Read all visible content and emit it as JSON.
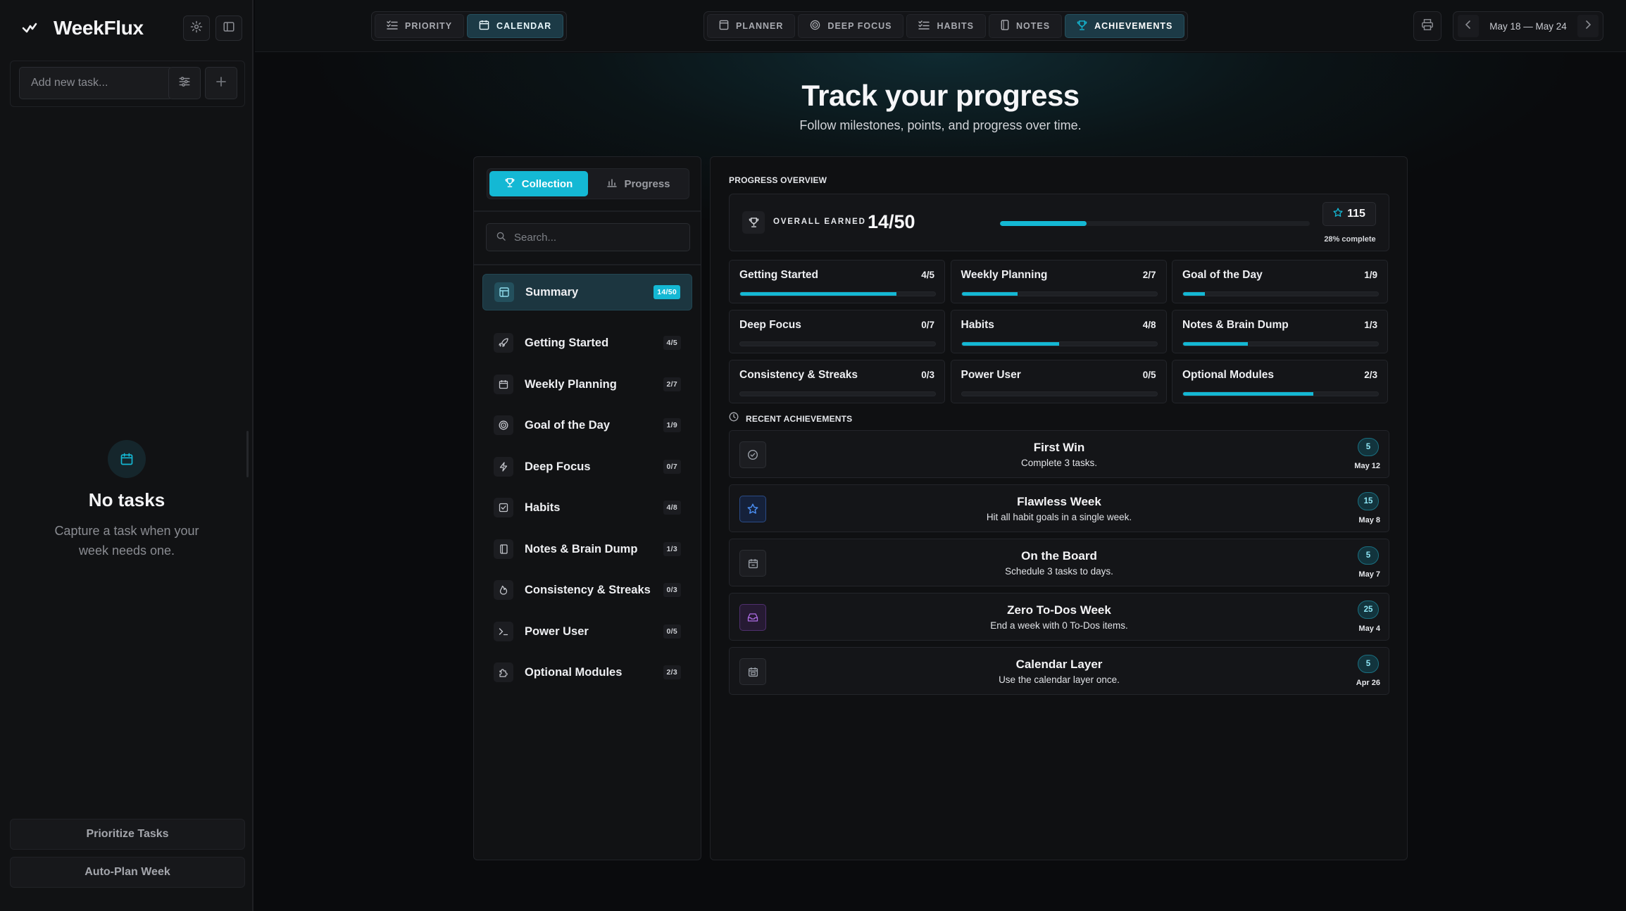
{
  "app": {
    "name": "WeekFlux"
  },
  "sidebar": {
    "add_task_placeholder": "Add new task...",
    "empty_title": "No tasks",
    "empty_subtitle": "Capture a task when your week needs one.",
    "prioritize_label": "Prioritize Tasks",
    "autoplan_label": "Auto-Plan Week"
  },
  "topbar": {
    "left_tabs": [
      {
        "label": "PRIORITY",
        "icon": "list-icon"
      },
      {
        "label": "CALENDAR",
        "icon": "calendar-icon"
      }
    ],
    "main_tabs": [
      {
        "label": "PLANNER",
        "icon": "planner-icon"
      },
      {
        "label": "DEEP FOCUS",
        "icon": "target-icon"
      },
      {
        "label": "HABITS",
        "icon": "checklist-icon"
      },
      {
        "label": "NOTES",
        "icon": "note-icon"
      },
      {
        "label": "ACHIEVEMENTS",
        "icon": "trophy-icon"
      }
    ],
    "week_range": "May 18 — May 24"
  },
  "hero": {
    "title": "Track your progress",
    "subtitle": "Follow milestones, points, and progress over time."
  },
  "left_panel": {
    "tabs": [
      {
        "label": "Collection"
      },
      {
        "label": "Progress"
      }
    ],
    "search_placeholder": "Search...",
    "summary": {
      "label": "Summary",
      "badge": "14/50"
    },
    "categories": [
      {
        "label": "Getting Started",
        "badge": "4/5"
      },
      {
        "label": "Weekly Planning",
        "badge": "2/7"
      },
      {
        "label": "Goal of the Day",
        "badge": "1/9"
      },
      {
        "label": "Deep Focus",
        "badge": "0/7"
      },
      {
        "label": "Habits",
        "badge": "4/8"
      },
      {
        "label": "Notes & Brain Dump",
        "badge": "1/3"
      },
      {
        "label": "Consistency & Streaks",
        "badge": "0/3"
      },
      {
        "label": "Power User",
        "badge": "0/5"
      },
      {
        "label": "Optional Modules",
        "badge": "2/3"
      }
    ]
  },
  "overview": {
    "section_label": "PROGRESS OVERVIEW",
    "overall_label": "OVERALL EARNED",
    "overall_value": "14/50",
    "overall_progress": 0.28,
    "points": "115",
    "percent_label": "28% complete",
    "grid": [
      {
        "name": "Getting Started",
        "count": "4/5",
        "progress": 0.8
      },
      {
        "name": "Weekly Planning",
        "count": "2/7",
        "progress": 0.286
      },
      {
        "name": "Goal of the Day",
        "count": "1/9",
        "progress": 0.111
      },
      {
        "name": "Deep Focus",
        "count": "0/7",
        "progress": 0
      },
      {
        "name": "Habits",
        "count": "4/8",
        "progress": 0.5
      },
      {
        "name": "Notes & Brain Dump",
        "count": "1/3",
        "progress": 0.333
      },
      {
        "name": "Consistency & Streaks",
        "count": "0/3",
        "progress": 0
      },
      {
        "name": "Power User",
        "count": "0/5",
        "progress": 0
      },
      {
        "name": "Optional Modules",
        "count": "2/3",
        "progress": 0.667
      }
    ]
  },
  "recent": {
    "section_label": "RECENT ACHIEVEMENTS",
    "items": [
      {
        "title": "First Win",
        "description": "Complete 3 tasks.",
        "points": "5",
        "date": "May 12",
        "icon": "check-circle-icon",
        "accent": "#9aa0a8"
      },
      {
        "title": "Flawless Week",
        "description": "Hit all habit goals in a single week.",
        "points": "15",
        "date": "May 8",
        "icon": "star-icon",
        "accent": "#4a8df0"
      },
      {
        "title": "On the Board",
        "description": "Schedule 3 tasks to days.",
        "points": "5",
        "date": "May 7",
        "icon": "calendar-board-icon",
        "accent": "#9aa0a8"
      },
      {
        "title": "Zero To-Dos Week",
        "description": "End a week with 0 To-Dos items.",
        "points": "25",
        "date": "May 4",
        "icon": "inbox-icon",
        "accent": "#b06ee8"
      },
      {
        "title": "Calendar Layer",
        "description": "Use the calendar layer once.",
        "points": "5",
        "date": "Apr 26",
        "icon": "calendar-layer-icon",
        "accent": "#9aa0a8"
      }
    ]
  },
  "colors": {
    "accent": "#14b8d4",
    "background": "#0a0b0d"
  }
}
